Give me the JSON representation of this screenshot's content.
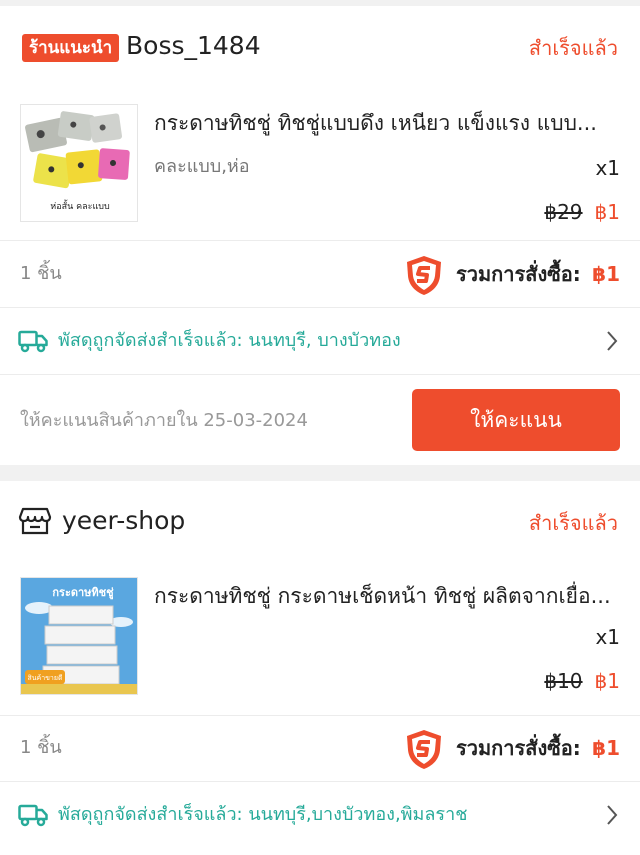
{
  "colors": {
    "accent": "#ee4d2d",
    "ship_green": "#26aa99"
  },
  "orders": [
    {
      "shop_badge": "ร้านแนะนำ",
      "shop_name": "Boss_1484",
      "status": "สำเร็จแล้ว",
      "product": {
        "title": "กระดาษทิชชู่ ทิชชู่แบบดึง เหนียว แข็งแรง  แบบ...",
        "variant": "คละแบบ,ห่อ",
        "thumb_caption": "ห่อสั้น คละแบบ",
        "qty": "x1",
        "old_price": "฿29",
        "new_price": "฿1"
      },
      "items_count": "1 ชิ้น",
      "total_label": "รวมการสั่งซื้อ:",
      "total_value": "฿1",
      "shipping": "พัสดุถูกจัดส่งสำเร็จแล้ว: นนทบุรี, บางบัวทอง",
      "rate_deadline": "ให้คะแนนสินค้าภายใน 25-03-2024",
      "rate_button": "ให้คะแนน"
    },
    {
      "shop_name": "yeer-shop",
      "status": "สำเร็จแล้ว",
      "product": {
        "title": "กระดาษทิชชู่ กระดาษเช็ดหน้า ทิชชู่ ผลิตจากเยื่อ...",
        "thumb_caption": "กระดาษทิชชู่",
        "thumb_tag": "สินค้าขายดี",
        "qty": "x1",
        "old_price": "฿10",
        "new_price": "฿1"
      },
      "items_count": "1 ชิ้น",
      "total_label": "รวมการสั่งซื้อ:",
      "total_value": "฿1",
      "shipping": "พัสดุถูกจัดส่งสำเร็จแล้ว: นนทบุรี,บางบัวทอง,พิมลราช"
    }
  ]
}
